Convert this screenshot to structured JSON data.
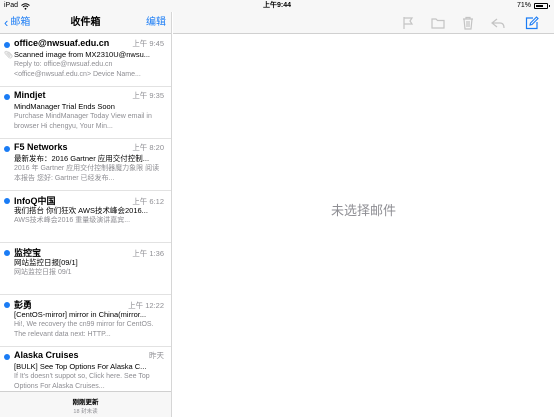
{
  "status_bar": {
    "device": "iPad",
    "time": "上午9:44",
    "battery": "71%",
    "battery_level": 0.71,
    "wifi_icon": "wifi-icon"
  },
  "nav": {
    "back_label": "邮箱",
    "title": "收件箱",
    "edit_label": "编辑"
  },
  "messages": [
    {
      "sender": "office@nwsuaf.edu.cn",
      "time": "上午 9:45",
      "subject": "Scanned image from MX2310U@nwsu...",
      "preview": "Reply to: office@nwsuaf.edu.cn <office@nwsuaf.edu.cn> Device Name...",
      "unread": true,
      "attachment": true
    },
    {
      "sender": "Mindjet",
      "time": "上午 9:35",
      "subject": "MindManager Trial Ends Soon",
      "preview": "Purchase MindManager Today View email in browser Hi chengyu, Your Min...",
      "unread": true,
      "attachment": false
    },
    {
      "sender": "F5 Networks",
      "time": "上午 8:20",
      "subject": "最新发布：2016 Gartner 应用交付控制...",
      "preview": "2016 年 Gartner 应用交付控制器魔力象限 阅读本报告 您好: Gartner 已经发布...",
      "unread": true,
      "attachment": false
    },
    {
      "sender": "InfoQ中国",
      "time": "上午 6:12",
      "subject": "我们搭台 你们狂欢 AWS技术峰会2016...",
      "preview": "AWS技术峰会2016 重量级演讲嘉宾...",
      "unread": true,
      "attachment": false
    },
    {
      "sender": "监控宝",
      "time": "上午 1:36",
      "subject": "网站监控日报[09/1]",
      "preview": "网站监控日报 09/1",
      "unread": true,
      "attachment": false
    },
    {
      "sender": "彭勇",
      "time": "上午 12:22",
      "subject": "[CentOS-mirror] mirror in China(mirror...",
      "preview": "Hi!, We recovery the cn99 mirror for CentOS. The relevant data next: HTTP...",
      "unread": true,
      "attachment": false
    },
    {
      "sender": "Alaska Cruises",
      "time": "昨天",
      "subject": "[BULK] See Top Options For Alaska C...",
      "preview": "If It's doesn't suppot so, Click here. See Top Options For Alaska Cruises...",
      "unread": true,
      "attachment": false
    }
  ],
  "footer": {
    "updated": "刚刚更新",
    "unread_count": "18 封未读"
  },
  "detail": {
    "empty_text": "未选择邮件"
  },
  "toolbar_icons": [
    "flag-icon",
    "folder-icon",
    "trash-icon",
    "reply-icon",
    "compose-icon"
  ],
  "colors": {
    "accent": "#1a7cf5",
    "secondary_text": "#8e8e93",
    "toolbar_bg": "#f7f7f7"
  }
}
